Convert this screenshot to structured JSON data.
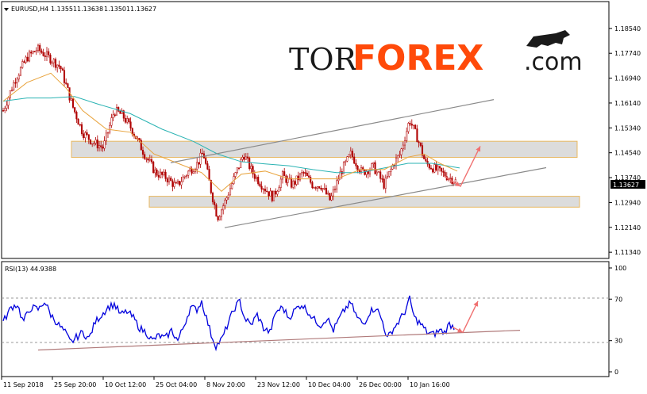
{
  "header": {
    "symbol": "EURUSD,H4",
    "open": "1.13551",
    "high": "1.13638",
    "low": "1.13501",
    "close": "1.13627"
  },
  "logo": {
    "part1": "TOR",
    "part2": "FOREX",
    "part3": ".com"
  },
  "rsi_label": "RSI(13) 44.9388",
  "current_price_label": "1.13627",
  "colors": {
    "candle": "#b00000",
    "ma_fast": "#e8a33c",
    "ma_slow": "#2ab3b3",
    "rsi_line": "#0000dd",
    "trendline": "#8a8a8a",
    "rsi_trendline": "#b07a7a",
    "zone_fill": "#dcdcdc",
    "zone_border": "#e8b860",
    "arrow": "#f07070",
    "price_box": "#000000"
  },
  "chart_data": [
    {
      "type": "candlestick",
      "symbol": "EURUSD",
      "timeframe": "H4",
      "x_tick_labels": [
        "11 Sep 2018",
        "25 Sep 20:00",
        "10 Oct 12:00",
        "25 Oct 04:00",
        "8 Nov 20:00",
        "23 Nov 12:00",
        "10 Dec 04:00",
        "26 Dec 00:00",
        "10 Jan 16:00"
      ],
      "y_tick_labels": [
        "1.18540",
        "1.17740",
        "1.16940",
        "1.16140",
        "1.15340",
        "1.14540",
        "1.13740",
        "1.12940",
        "1.12140",
        "1.11340"
      ],
      "ylim": [
        1.1114,
        1.1874
      ],
      "close_path": [
        [
          0,
          1.159
        ],
        [
          15,
          1.169
        ],
        [
          30,
          1.176
        ],
        [
          43,
          1.1788
        ],
        [
          58,
          1.176
        ],
        [
          72,
          1.173
        ],
        [
          88,
          1.16
        ],
        [
          100,
          1.152
        ],
        [
          112,
          1.149
        ],
        [
          126,
          1.147
        ],
        [
          140,
          1.159
        ],
        [
          150,
          1.1575
        ],
        [
          162,
          1.153
        ],
        [
          178,
          1.145
        ],
        [
          192,
          1.139
        ],
        [
          205,
          1.1375
        ],
        [
          218,
          1.1345
        ],
        [
          232,
          1.139
        ],
        [
          245,
          1.142
        ],
        [
          252,
          1.1455
        ],
        [
          262,
          1.133
        ],
        [
          270,
          1.1245
        ],
        [
          280,
          1.13
        ],
        [
          292,
          1.138
        ],
        [
          303,
          1.145
        ],
        [
          314,
          1.139
        ],
        [
          326,
          1.135
        ],
        [
          340,
          1.131
        ],
        [
          352,
          1.138
        ],
        [
          364,
          1.135
        ],
        [
          378,
          1.139
        ],
        [
          390,
          1.135
        ],
        [
          400,
          1.135
        ],
        [
          412,
          1.13
        ],
        [
          425,
          1.139
        ],
        [
          438,
          1.145
        ],
        [
          452,
          1.139
        ],
        [
          466,
          1.141
        ],
        [
          480,
          1.135
        ],
        [
          492,
          1.142
        ],
        [
          500,
          1.145
        ],
        [
          512,
          1.156
        ],
        [
          522,
          1.15
        ],
        [
          532,
          1.142
        ],
        [
          545,
          1.14
        ],
        [
          558,
          1.138
        ],
        [
          570,
          1.1363
        ]
      ],
      "ma_fast_path": [
        [
          0,
          1.162
        ],
        [
          30,
          1.168
        ],
        [
          60,
          1.171
        ],
        [
          80,
          1.166
        ],
        [
          100,
          1.159
        ],
        [
          130,
          1.153
        ],
        [
          160,
          1.152
        ],
        [
          190,
          1.145
        ],
        [
          220,
          1.142
        ],
        [
          250,
          1.139
        ],
        [
          275,
          1.133
        ],
        [
          300,
          1.1385
        ],
        [
          330,
          1.1395
        ],
        [
          360,
          1.137
        ],
        [
          390,
          1.137
        ],
        [
          420,
          1.137
        ],
        [
          450,
          1.14
        ],
        [
          480,
          1.14
        ],
        [
          510,
          1.144
        ],
        [
          530,
          1.145
        ],
        [
          550,
          1.142
        ],
        [
          572,
          1.1395
        ]
      ],
      "ma_slow_path": [
        [
          0,
          1.162
        ],
        [
          30,
          1.163
        ],
        [
          60,
          1.163
        ],
        [
          90,
          1.1635
        ],
        [
          120,
          1.161
        ],
        [
          160,
          1.158
        ],
        [
          200,
          1.153
        ],
        [
          240,
          1.149
        ],
        [
          270,
          1.145
        ],
        [
          300,
          1.1425
        ],
        [
          330,
          1.1418
        ],
        [
          360,
          1.1412
        ],
        [
          390,
          1.14
        ],
        [
          420,
          1.139
        ],
        [
          450,
          1.139
        ],
        [
          480,
          1.1405
        ],
        [
          510,
          1.142
        ],
        [
          540,
          1.142
        ],
        [
          575,
          1.1405
        ]
      ],
      "resistance_zone": [
        1.1439,
        1.1491
      ],
      "support_zone": [
        1.1279,
        1.1314
      ],
      "upper_channel": [
        [
          215,
          1.1422
        ],
        [
          622,
          1.1625
        ]
      ],
      "lower_channel": [
        [
          283,
          1.1213
        ],
        [
          688,
          1.1406
        ]
      ],
      "forecast_arrow": [
        [
          560,
          1.1378
        ],
        [
          580,
          1.1346
        ],
        [
          605,
          1.1475
        ]
      ]
    },
    {
      "type": "line",
      "name": "RSI(13)",
      "y_tick_labels": [
        "100",
        "70",
        "30",
        "0"
      ],
      "ylim": [
        0,
        100
      ],
      "levels": [
        70,
        30
      ],
      "path": [
        [
          0,
          48
        ],
        [
          10,
          62
        ],
        [
          18,
          65
        ],
        [
          25,
          48
        ],
        [
          35,
          62
        ],
        [
          45,
          60
        ],
        [
          52,
          68
        ],
        [
          60,
          55
        ],
        [
          70,
          45
        ],
        [
          78,
          38
        ],
        [
          85,
          28
        ],
        [
          92,
          33
        ],
        [
          100,
          38
        ],
        [
          108,
          32
        ],
        [
          116,
          48
        ],
        [
          124,
          55
        ],
        [
          132,
          62
        ],
        [
          140,
          65
        ],
        [
          148,
          55
        ],
        [
          156,
          58
        ],
        [
          164,
          52
        ],
        [
          172,
          42
        ],
        [
          180,
          38
        ],
        [
          188,
          30
        ],
        [
          196,
          35
        ],
        [
          204,
          32
        ],
        [
          212,
          40
        ],
        [
          220,
          30
        ],
        [
          228,
          45
        ],
        [
          236,
          62
        ],
        [
          244,
          60
        ],
        [
          250,
          68
        ],
        [
          256,
          52
        ],
        [
          262,
          36
        ],
        [
          268,
          25
        ],
        [
          276,
          32
        ],
        [
          284,
          48
        ],
        [
          292,
          62
        ],
        [
          298,
          68
        ],
        [
          304,
          52
        ],
        [
          312,
          45
        ],
        [
          320,
          55
        ],
        [
          328,
          42
        ],
        [
          336,
          38
        ],
        [
          344,
          58
        ],
        [
          352,
          62
        ],
        [
          360,
          52
        ],
        [
          368,
          60
        ],
        [
          376,
          65
        ],
        [
          384,
          58
        ],
        [
          392,
          50
        ],
        [
          400,
          45
        ],
        [
          408,
          52
        ],
        [
          416,
          40
        ],
        [
          424,
          52
        ],
        [
          432,
          62
        ],
        [
          438,
          66
        ],
        [
          446,
          52
        ],
        [
          454,
          46
        ],
        [
          462,
          58
        ],
        [
          470,
          62
        ],
        [
          478,
          48
        ],
        [
          484,
          32
        ],
        [
          490,
          40
        ],
        [
          498,
          48
        ],
        [
          506,
          58
        ],
        [
          512,
          70
        ],
        [
          518,
          52
        ],
        [
          526,
          46
        ],
        [
          534,
          38
        ],
        [
          542,
          36
        ],
        [
          550,
          40
        ],
        [
          556,
          38
        ],
        [
          562,
          46
        ],
        [
          568,
          43
        ]
      ],
      "trendline": [
        [
          48,
          21
        ],
        [
          655,
          40
        ]
      ],
      "forecast_arrow": [
        [
          570,
          43
        ],
        [
          583,
          38
        ],
        [
          602,
          68
        ]
      ]
    }
  ]
}
